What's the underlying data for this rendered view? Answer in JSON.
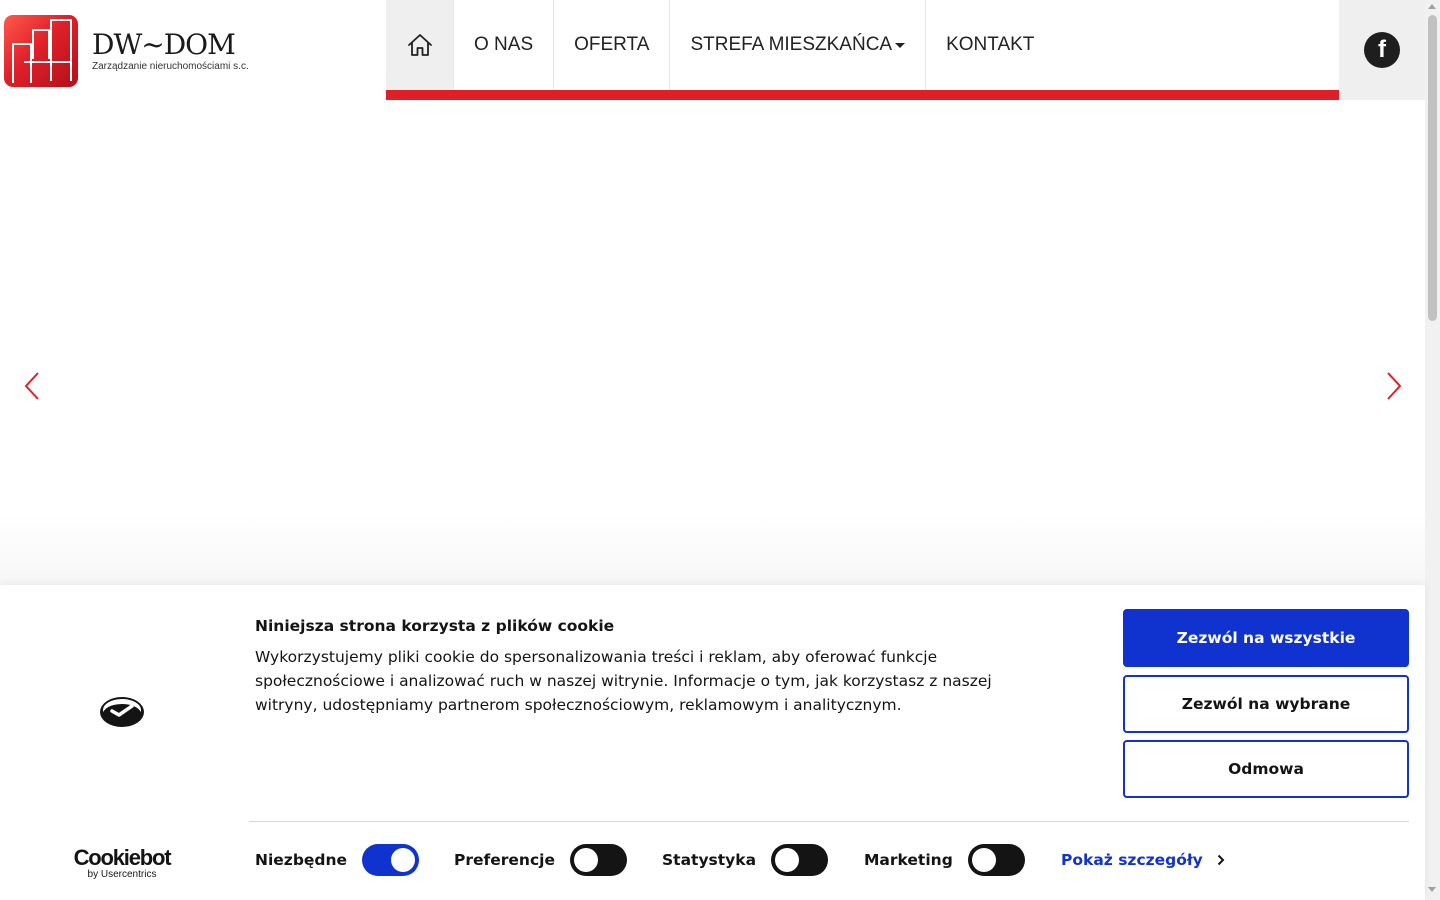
{
  "header": {
    "logo": {
      "title": "DW~DOM",
      "subtitle": "Zarządzanie nieruchomościami s.c."
    },
    "nav": {
      "home_icon": "home-icon",
      "items": [
        {
          "label": "O NAS"
        },
        {
          "label": "OFERTA"
        },
        {
          "label": "STREFA MIESZKAŃCA",
          "dropdown": true
        },
        {
          "label": "KONTAKT"
        }
      ],
      "accent_color": "#e01e26"
    },
    "social": {
      "icon": "facebook-icon",
      "glyph": "f"
    }
  },
  "carousel": {
    "prev_icon": "chevron-left-icon",
    "next_icon": "chevron-right-icon",
    "arrow_color": "#e01e26"
  },
  "cookie_banner": {
    "title": "Niniejsza strona korzysta z plików cookie",
    "text": "Wykorzystujemy pliki cookie do spersonalizowania treści i reklam, aby oferować funkcje społecznościowe i analizować ruch w naszej witrynie. Informacje o tym, jak korzystasz z naszej witryny, udostępniamy partnerom społecznościowym, reklamowym i analitycznym.",
    "buttons": {
      "allow_all": "Zezwól na wszystkie",
      "allow_selected": "Zezwól na wybrane",
      "deny": "Odmowa"
    },
    "brand": {
      "name": "Cookiebot",
      "by": "by Usercentrics"
    },
    "toggles": [
      {
        "label": "Niezbędne",
        "on": true
      },
      {
        "label": "Preferencje",
        "on": false
      },
      {
        "label": "Statystyka",
        "on": false
      },
      {
        "label": "Marketing",
        "on": false
      }
    ],
    "details_link": "Pokaż szczegóły",
    "accent_color": "#1032cf"
  }
}
